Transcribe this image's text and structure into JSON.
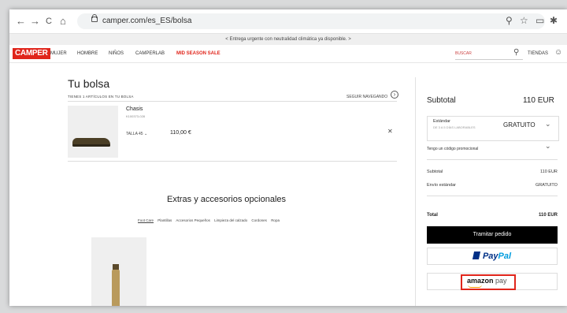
{
  "browser": {
    "url": "camper.com/es_ES/bolsa",
    "back": "←",
    "forward": "→",
    "reload": "C",
    "home": "⌂"
  },
  "promo_bar": "< Entrega urgente con neutralidad climática ya disponible. >",
  "header": {
    "logo": "CAMPER",
    "menu": [
      "MUJER",
      "HOMBRE",
      "NIÑOS",
      "CAMPERLAB"
    ],
    "sale": "MID SEASON SALE",
    "search_placeholder": "BUSCAR",
    "stores": "TIENDAS"
  },
  "bag": {
    "title": "Tu bolsa",
    "count": "TIENES 1 ARTÍCULOS EN TU BOLSA",
    "continue": "SEGUIR NAVEGANDO",
    "item": {
      "name": "Chasis",
      "ref": "K100373-028",
      "size": "TALLA 45",
      "price": "110,00 €"
    }
  },
  "extras": {
    "title": "Extras y accesorios opcionales",
    "tabs": [
      "Foot Care",
      "Plantillas",
      "Accesorios Pequeños",
      "Limpieza del calzado",
      "Cordones",
      "Ropa"
    ]
  },
  "summary": {
    "subtotal_label": "Subtotal",
    "subtotal_value": "110 EUR",
    "shipping_name": "Estándar",
    "shipping_eta": "DE 3 A 5 DÍAS LABORABLES",
    "shipping_value": "GRATUITO",
    "promo_code": "Tengo un código promocional",
    "rows": [
      {
        "label": "Subtotal",
        "value": "110 EUR"
      },
      {
        "label": "Envío estándar",
        "value": "GRATUITO"
      }
    ],
    "total_label": "Total",
    "total_value": "110 EUR",
    "checkout": "Tramitar pedido",
    "paypal_1": "Pay",
    "paypal_2": "Pal",
    "amazon_1": "amazon",
    "amazon_2": " pay"
  },
  "colors": {
    "brand": "#e0251b",
    "checkout_bg": "#000000",
    "paypal_dark": "#003087",
    "paypal_light": "#009cde"
  }
}
